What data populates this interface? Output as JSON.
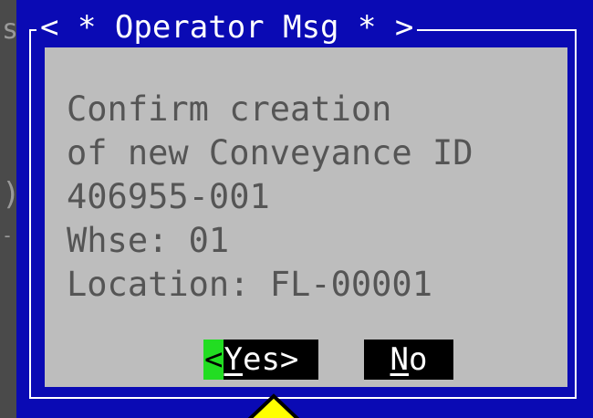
{
  "background": {
    "glyphs": [
      "s",
      ")",
      "-"
    ]
  },
  "dialog": {
    "title": "< * Operator Msg * >",
    "message_lines": [
      "Confirm creation",
      "of new Conveyance ID",
      "406955-001",
      "Whse: 01",
      "Location: FL-00001"
    ],
    "buttons": {
      "yes": {
        "focus_left": "<",
        "hotkey": "Y",
        "rest": "es",
        "focus_right": ">"
      },
      "no": {
        "hotkey": "N",
        "rest": "o"
      }
    },
    "focused_button": "yes"
  },
  "pointer": {
    "icon": "triangle-pointer-icon",
    "color": "#ffff00"
  },
  "colors": {
    "dialog_bg": "#0a0ab4",
    "content_bg": "#bdbdbd",
    "text": "#555555",
    "focus": "#22dd22"
  }
}
